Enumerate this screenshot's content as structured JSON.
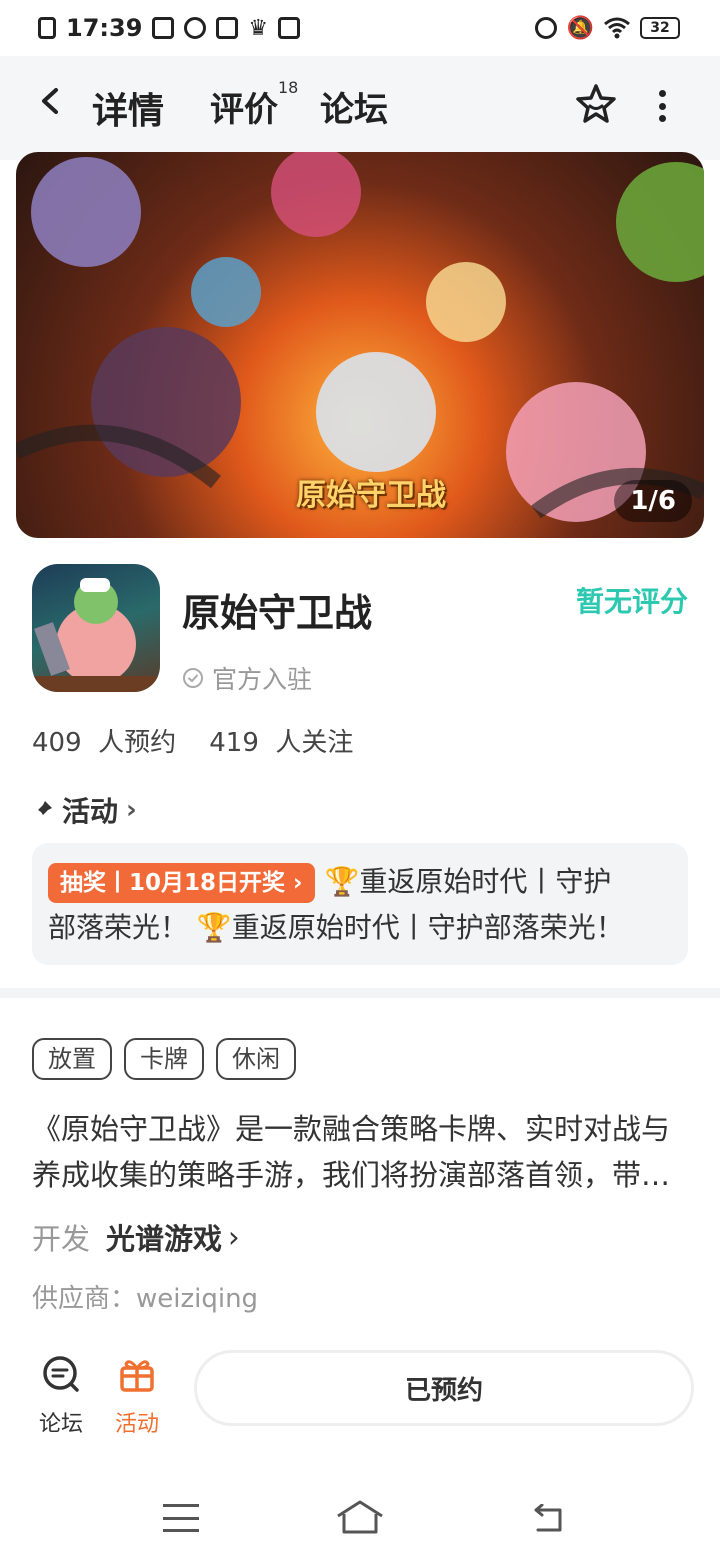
{
  "status_bar": {
    "time": "17:39",
    "battery": "32",
    "icons": [
      "sim-icon",
      "video-icon",
      "link-icon",
      "card-icon",
      "crown-icon",
      "mail-icon",
      "alarm-icon",
      "mute-icon",
      "wifi-icon"
    ]
  },
  "header": {
    "tabs": [
      {
        "label": "详情",
        "active": true
      },
      {
        "label": "评价",
        "badge": "18"
      },
      {
        "label": "论坛"
      }
    ],
    "icons": [
      "back-icon",
      "star-icon",
      "more-icon"
    ]
  },
  "banner": {
    "counter": "1/6",
    "logo_text": "原始守卫战"
  },
  "app": {
    "name": "原始守卫战",
    "official": "官方入驻",
    "rating": "暂无评分",
    "reservations": "409",
    "reservations_label": "人预约",
    "followers": "419",
    "followers_label": "人关注"
  },
  "activity": {
    "title": "活动",
    "tag": "抽奖丨10月18日开奖",
    "line1": "🏆重返原始时代丨守护",
    "line2": "部落荣光！  🏆重返原始时代丨守护部落荣光！"
  },
  "tags": [
    "放置",
    "卡牌",
    "休闲"
  ],
  "description": "《原始守卫战》是一款融合策略卡牌、实时对战与养成收集的策略手游，我们将扮演部落首领，带领族人守卫家园。",
  "developer": {
    "label": "开发",
    "name": "光谱游戏"
  },
  "supplier": "供应商：weiziqing",
  "bottom_bar": {
    "forum_label": "论坛",
    "activity_label": "活动",
    "reserved_label": "已预约"
  },
  "colors": {
    "accent": "#2ccfb1",
    "orange": "#f26a37",
    "rating": "#2cc9b0"
  }
}
